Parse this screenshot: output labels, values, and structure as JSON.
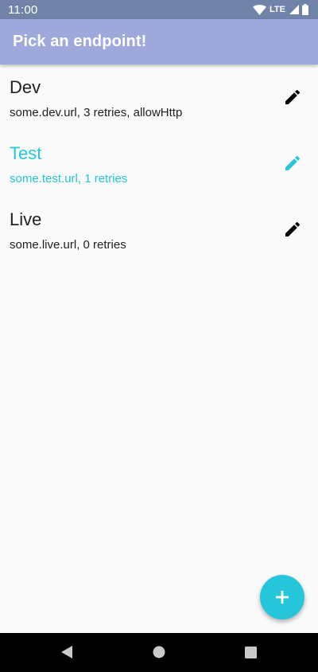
{
  "status_bar": {
    "time": "11:00",
    "network": "LTE",
    "icons": [
      "wifi-icon",
      "signal-icon",
      "battery-icon"
    ]
  },
  "app_bar": {
    "title": "Pick an endpoint!"
  },
  "endpoints": [
    {
      "name": "Dev",
      "detail": "some.dev.url, 3 retries, allowHttp",
      "selected": false
    },
    {
      "name": "Test",
      "detail": "some.test.url, 1 retries",
      "selected": true
    },
    {
      "name": "Live",
      "detail": "some.live.url, 0 retries",
      "selected": false
    }
  ],
  "fab": {
    "icon": "plus-icon"
  },
  "nav_bar": {
    "icons": [
      "back-icon",
      "home-icon",
      "recents-icon"
    ]
  },
  "colors": {
    "status_bar": "#7283aa",
    "app_bar": "#9fa8da",
    "accent": "#26c6da",
    "text_primary": "#212121",
    "background": "#fafafa",
    "nav_bar": "#000000"
  }
}
